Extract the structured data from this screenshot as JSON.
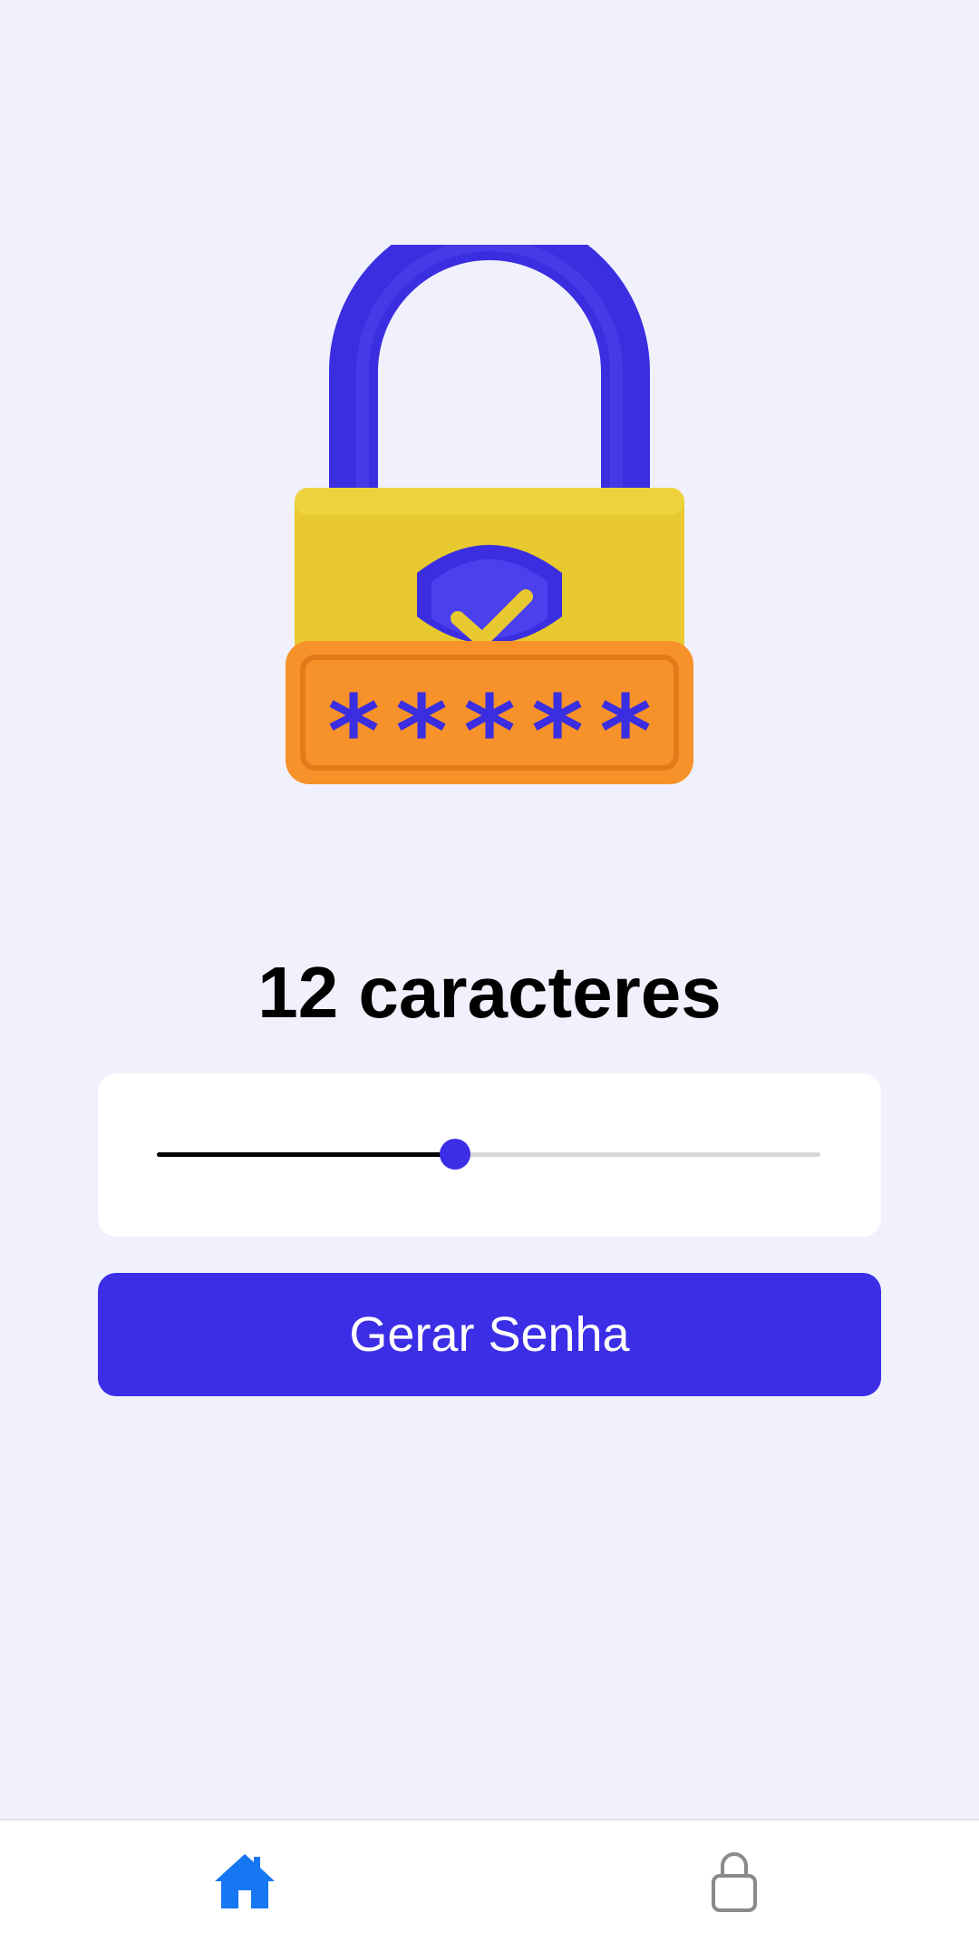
{
  "main": {
    "title": "12 caracteres",
    "length": 12,
    "length_fraction": 0.45
  },
  "actions": {
    "generate_label": "Gerar Senha"
  },
  "hero": {
    "icon": "padlock-password-icon",
    "masked_text": "*****"
  },
  "tabs": [
    {
      "icon": "home-icon",
      "active": true
    },
    {
      "icon": "lock-icon",
      "active": false
    }
  ],
  "colors": {
    "background": "#f1f1fd",
    "accent": "#3b2ee6",
    "active_tab": "#1677f2",
    "inactive_tab": "#8a8a8e",
    "lock_body": "#e8c92f",
    "lock_plate": "#f7922a"
  }
}
